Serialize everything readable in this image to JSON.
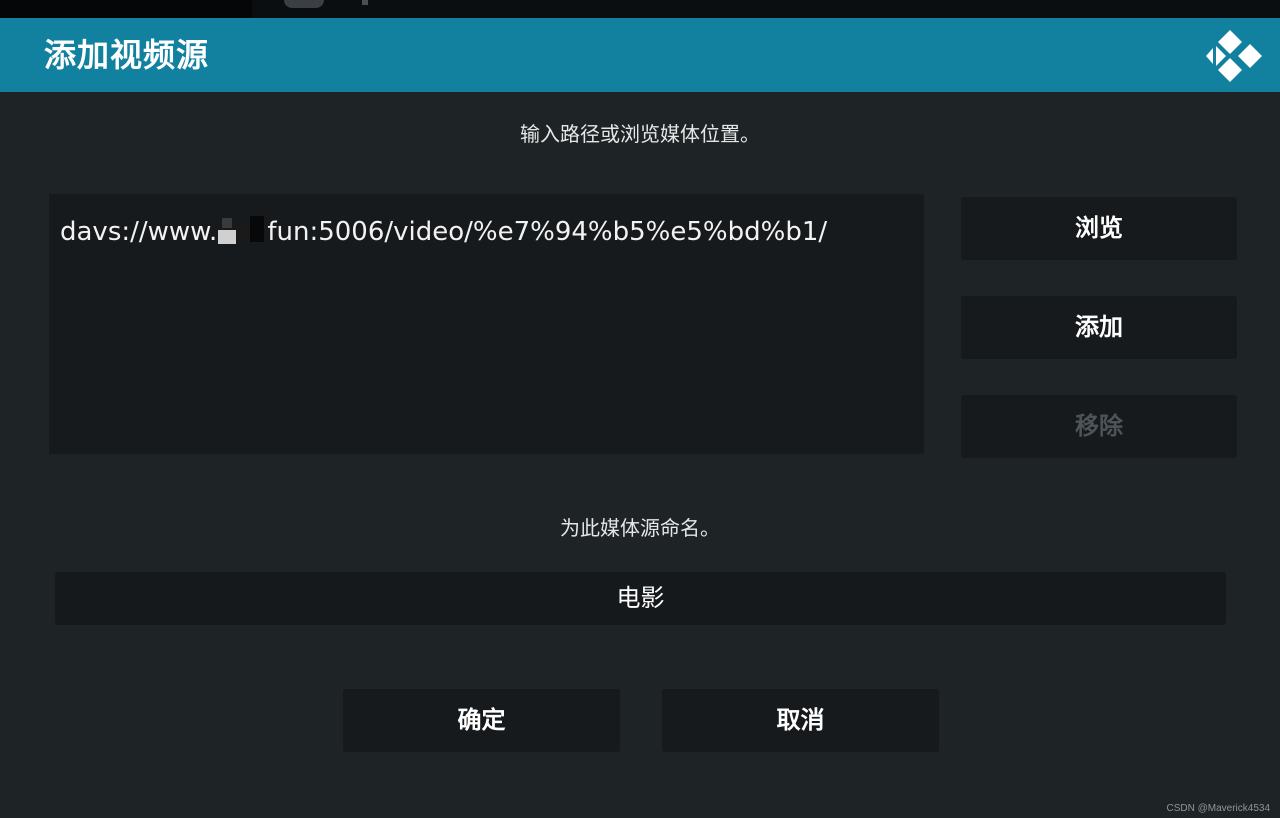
{
  "dialog": {
    "title": "添加视频源",
    "path_prompt": "输入路径或浏览媒体位置。",
    "paths": [
      {
        "prefix": "davs://www.",
        "suffix": "fun:5006/video/%e7%94%b5%e5%bd%b1/"
      }
    ],
    "buttons": {
      "browse": "浏览",
      "add": "添加",
      "remove": "移除"
    },
    "name_prompt": "为此媒体源命名。",
    "name_value": "电影",
    "ok": "确定",
    "cancel": "取消"
  },
  "watermark": "CSDN @Maverick4534",
  "colors": {
    "header": "#12809f",
    "dialog_bg": "#1e2326",
    "control_bg": "#161a1c",
    "disabled_text": "#4d5357"
  },
  "icons": {
    "logo": "kodi-logo-icon"
  }
}
